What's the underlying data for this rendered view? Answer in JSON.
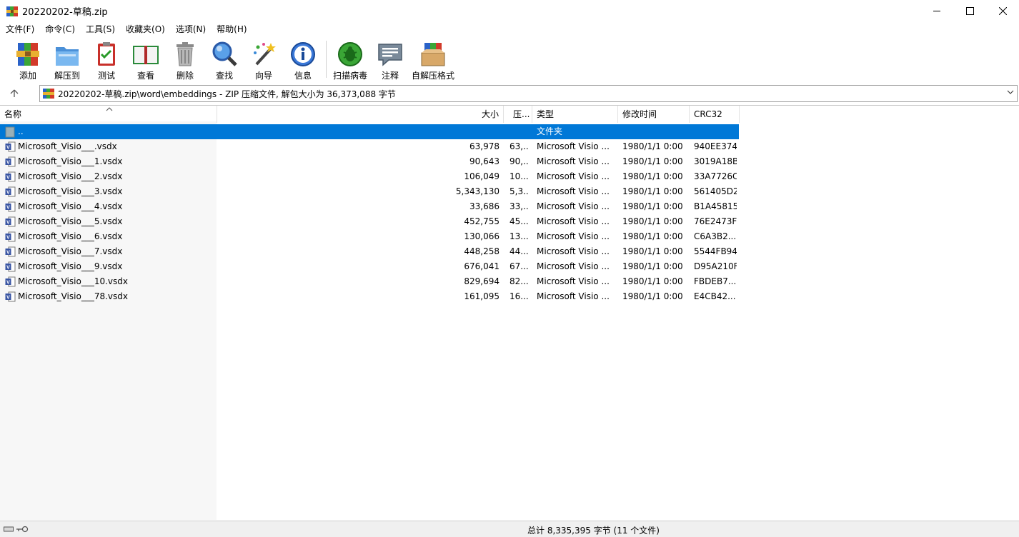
{
  "window": {
    "title": "20220202-草稿.zip",
    "controls": {
      "minimize": "minimize-icon",
      "maximize": "maximize-icon",
      "close": "close-icon"
    }
  },
  "menu": [
    "文件(F)",
    "命令(C)",
    "工具(S)",
    "收藏夹(O)",
    "选项(N)",
    "帮助(H)"
  ],
  "toolbar": [
    {
      "label": "添加",
      "icon": "add-archive-icon"
    },
    {
      "label": "解压到",
      "icon": "extract-folder-icon"
    },
    {
      "label": "测试",
      "icon": "test-clipboard-icon"
    },
    {
      "label": "查看",
      "icon": "view-book-icon"
    },
    {
      "label": "删除",
      "icon": "trash-icon"
    },
    {
      "label": "查找",
      "icon": "magnifier-icon"
    },
    {
      "label": "向导",
      "icon": "wizard-wand-icon"
    },
    {
      "label": "信息",
      "icon": "info-icon"
    },
    {
      "label": "扫描病毒",
      "icon": "virus-scan-icon"
    },
    {
      "label": "注释",
      "icon": "comment-icon"
    },
    {
      "label": "自解压格式",
      "icon": "sfx-box-icon"
    }
  ],
  "address": {
    "text": "20220202-草稿.zip\\word\\embeddings - ZIP 压缩文件, 解包大小为 36,373,088 字节"
  },
  "columns": {
    "name": "名称",
    "size": "大小",
    "packed": "压...",
    "type": "类型",
    "modified": "修改时间",
    "crc": "CRC32"
  },
  "parent_row": {
    "name": "..",
    "type": "文件夹"
  },
  "files": [
    {
      "name": "Microsoft_Visio___.vsdx",
      "size": "63,978",
      "packed": "63,...",
      "type": "Microsoft Visio ...",
      "modified": "1980/1/1 0:00",
      "crc": "940EE374"
    },
    {
      "name": "Microsoft_Visio___1.vsdx",
      "size": "90,643",
      "packed": "90,...",
      "type": "Microsoft Visio ...",
      "modified": "1980/1/1 0:00",
      "crc": "3019A18B"
    },
    {
      "name": "Microsoft_Visio___2.vsdx",
      "size": "106,049",
      "packed": "10...",
      "type": "Microsoft Visio ...",
      "modified": "1980/1/1 0:00",
      "crc": "33A7726C"
    },
    {
      "name": "Microsoft_Visio___3.vsdx",
      "size": "5,343,130",
      "packed": "5,3...",
      "type": "Microsoft Visio ...",
      "modified": "1980/1/1 0:00",
      "crc": "561405D2"
    },
    {
      "name": "Microsoft_Visio___4.vsdx",
      "size": "33,686",
      "packed": "33,...",
      "type": "Microsoft Visio ...",
      "modified": "1980/1/1 0:00",
      "crc": "B1A45815"
    },
    {
      "name": "Microsoft_Visio___5.vsdx",
      "size": "452,755",
      "packed": "45...",
      "type": "Microsoft Visio ...",
      "modified": "1980/1/1 0:00",
      "crc": "76E2473F"
    },
    {
      "name": "Microsoft_Visio___6.vsdx",
      "size": "130,066",
      "packed": "13...",
      "type": "Microsoft Visio ...",
      "modified": "1980/1/1 0:00",
      "crc": "C6A3B2..."
    },
    {
      "name": "Microsoft_Visio___7.vsdx",
      "size": "448,258",
      "packed": "44...",
      "type": "Microsoft Visio ...",
      "modified": "1980/1/1 0:00",
      "crc": "5544FB94"
    },
    {
      "name": "Microsoft_Visio___9.vsdx",
      "size": "676,041",
      "packed": "67...",
      "type": "Microsoft Visio ...",
      "modified": "1980/1/1 0:00",
      "crc": "D95A210F"
    },
    {
      "name": "Microsoft_Visio___10.vsdx",
      "size": "829,694",
      "packed": "82...",
      "type": "Microsoft Visio ...",
      "modified": "1980/1/1 0:00",
      "crc": "FBDEB7..."
    },
    {
      "name": "Microsoft_Visio___78.vsdx",
      "size": "161,095",
      "packed": "16...",
      "type": "Microsoft Visio ...",
      "modified": "1980/1/1 0:00",
      "crc": "E4CB42..."
    }
  ],
  "status": {
    "text": "总计 8,335,395 字节 (11 个文件)"
  },
  "colors": {
    "selection": "#0078d7",
    "name_column_bg": "#f7f7f7"
  }
}
